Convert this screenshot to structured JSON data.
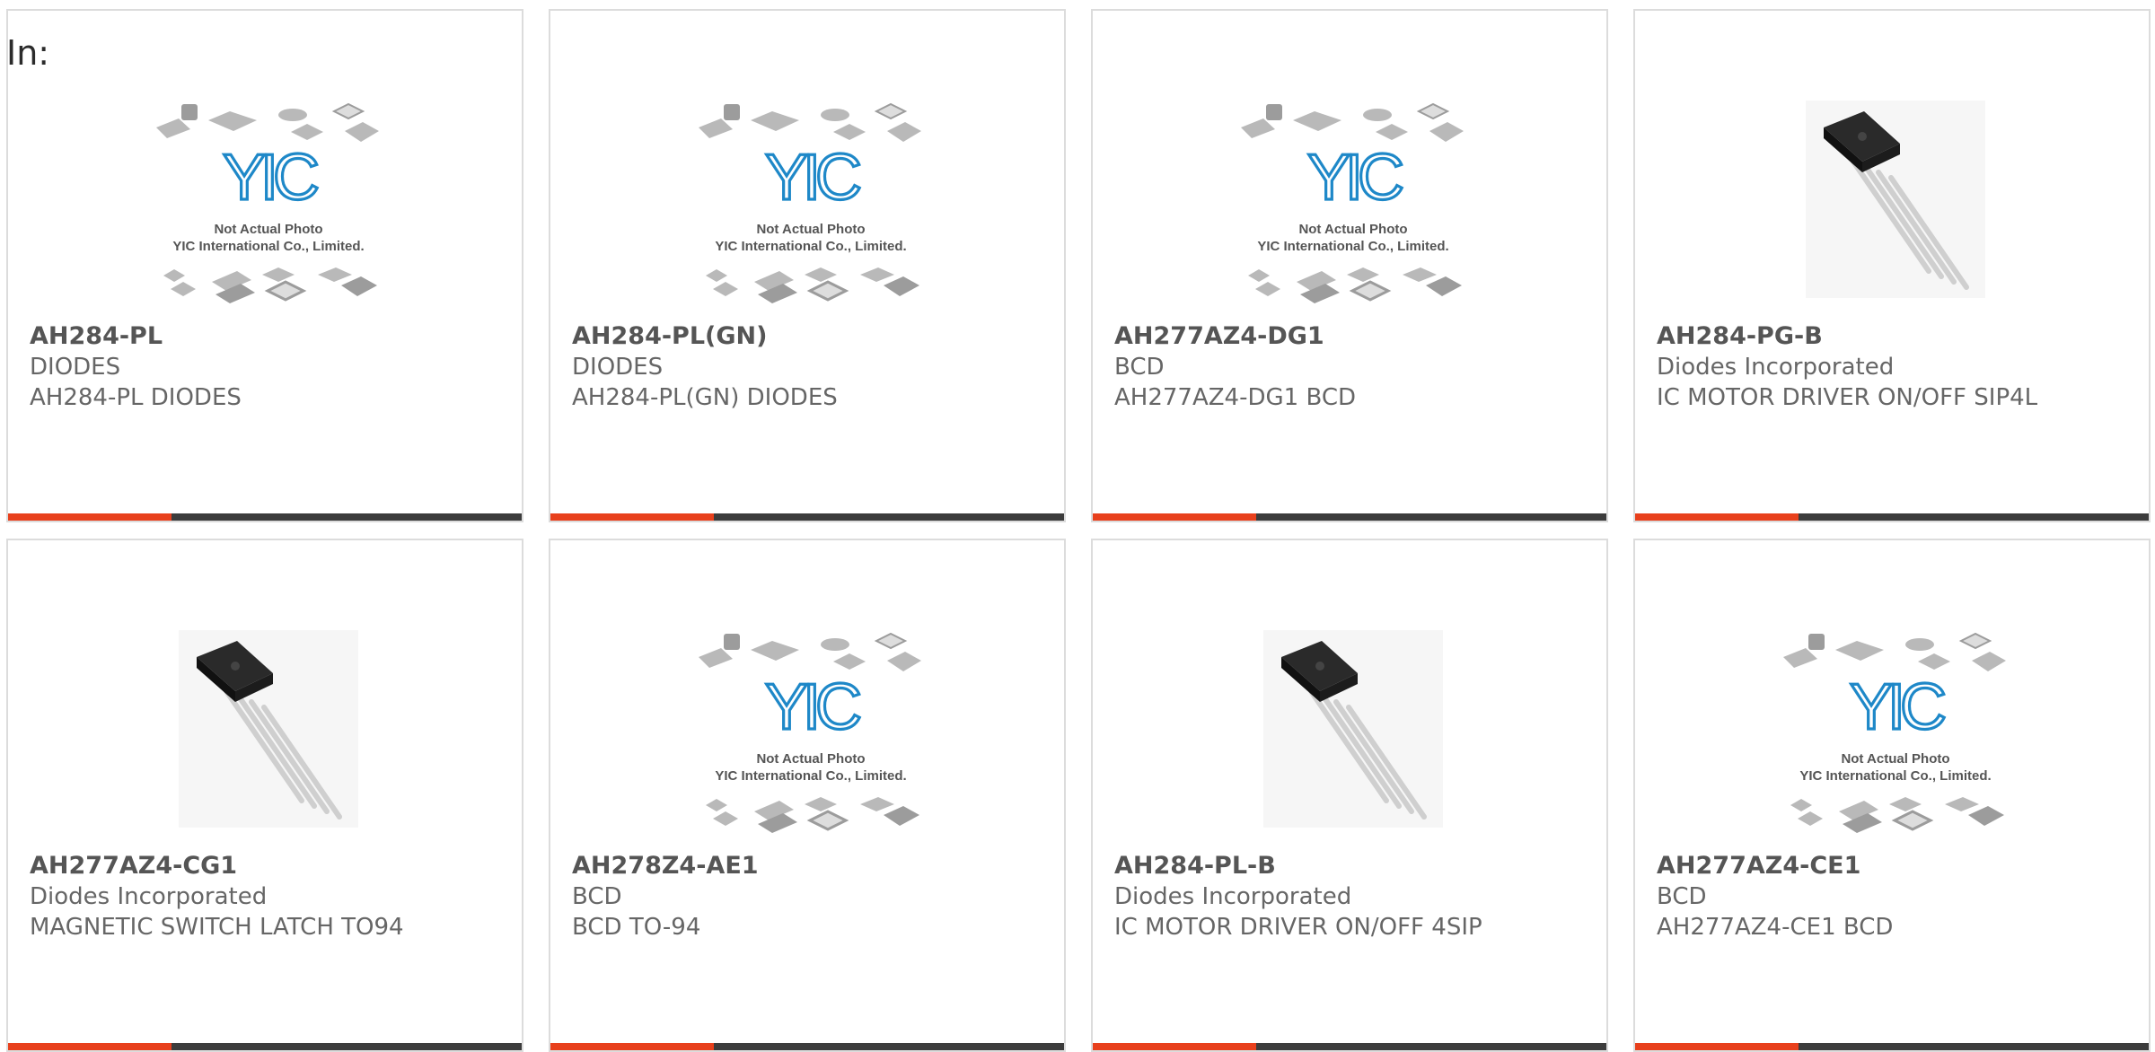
{
  "page": {
    "label": "In:"
  },
  "products": [
    {
      "part": "AH284-PL",
      "manufacturer": "DIODES",
      "description": "AH284-PL DIODES",
      "image": "placeholder",
      "placeholder_text": [
        "Not Actual Photo",
        "YIC International Co., Limited."
      ],
      "logo": "YIC"
    },
    {
      "part": "AH284-PL(GN)",
      "manufacturer": "DIODES",
      "description": "AH284-PL(GN) DIODES",
      "image": "placeholder",
      "placeholder_text": [
        "Not Actual Photo",
        "YIC International Co., Limited."
      ],
      "logo": "YIC"
    },
    {
      "part": "AH277AZ4-DG1",
      "manufacturer": "BCD",
      "description": "AH277AZ4-DG1 BCD",
      "image": "placeholder",
      "placeholder_text": [
        "Not Actual Photo",
        "YIC International Co., Limited."
      ],
      "logo": "YIC"
    },
    {
      "part": "AH284-PG-B",
      "manufacturer": "Diodes Incorporated",
      "description": "IC MOTOR DRIVER ON/OFF SIP4L",
      "image": "to94-chip"
    },
    {
      "part": "AH277AZ4-CG1",
      "manufacturer": "Diodes Incorporated",
      "description": "MAGNETIC SWITCH LATCH TO94",
      "image": "to94-chip"
    },
    {
      "part": "AH278Z4-AE1",
      "manufacturer": "BCD",
      "description": "BCD TO-94",
      "image": "placeholder",
      "placeholder_text": [
        "Not Actual Photo",
        "YIC International Co., Limited."
      ],
      "logo": "YIC"
    },
    {
      "part": "AH284-PL-B",
      "manufacturer": "Diodes Incorporated",
      "description": "IC MOTOR DRIVER ON/OFF 4SIP",
      "image": "to94-chip"
    },
    {
      "part": "AH277AZ4-CE1",
      "manufacturer": "BCD",
      "description": "AH277AZ4-CE1 BCD",
      "image": "placeholder",
      "placeholder_text": [
        "Not Actual Photo",
        "YIC International Co., Limited."
      ],
      "logo": "YIC"
    }
  ],
  "colors": {
    "accent": "#e8401c",
    "bar": "#3c3c3c",
    "border": "#dcdcdc",
    "logo": "#1e88c8"
  }
}
